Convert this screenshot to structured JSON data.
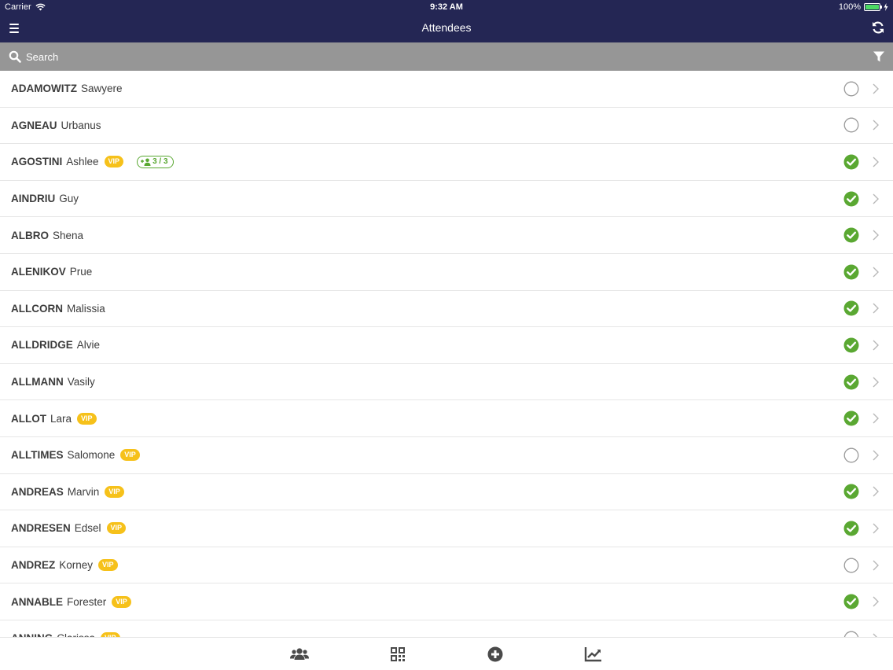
{
  "status_bar": {
    "carrier": "Carrier",
    "time": "9:32 AM",
    "battery": "100%"
  },
  "nav": {
    "title": "Attendees"
  },
  "search": {
    "placeholder": "Search"
  },
  "vip_label": "VIP",
  "attendees": [
    {
      "last": "ADAMOWITZ",
      "first": "Sawyere",
      "vip": false,
      "group": null,
      "checked_in": false
    },
    {
      "last": "AGNEAU",
      "first": "Urbanus",
      "vip": false,
      "group": null,
      "checked_in": false
    },
    {
      "last": "AGOSTINI",
      "first": "Ashlee",
      "vip": true,
      "group": "3 / 3",
      "checked_in": true
    },
    {
      "last": "AINDRIU",
      "first": "Guy",
      "vip": false,
      "group": null,
      "checked_in": true
    },
    {
      "last": "ALBRO",
      "first": "Shena",
      "vip": false,
      "group": null,
      "checked_in": true
    },
    {
      "last": "ALENIKOV",
      "first": "Prue",
      "vip": false,
      "group": null,
      "checked_in": true
    },
    {
      "last": "ALLCORN",
      "first": "Malissia",
      "vip": false,
      "group": null,
      "checked_in": true
    },
    {
      "last": "ALLDRIDGE",
      "first": "Alvie",
      "vip": false,
      "group": null,
      "checked_in": true
    },
    {
      "last": "ALLMANN",
      "first": "Vasily",
      "vip": false,
      "group": null,
      "checked_in": true
    },
    {
      "last": "ALLOT",
      "first": "Lara",
      "vip": true,
      "group": null,
      "checked_in": true
    },
    {
      "last": "ALLTIMES",
      "first": "Salomone",
      "vip": true,
      "group": null,
      "checked_in": false
    },
    {
      "last": "ANDREAS",
      "first": "Marvin",
      "vip": true,
      "group": null,
      "checked_in": true
    },
    {
      "last": "ANDRESEN",
      "first": "Edsel",
      "vip": true,
      "group": null,
      "checked_in": true
    },
    {
      "last": "ANDREZ",
      "first": "Korney",
      "vip": true,
      "group": null,
      "checked_in": false
    },
    {
      "last": "ANNABLE",
      "first": "Forester",
      "vip": true,
      "group": null,
      "checked_in": true
    },
    {
      "last": "ANNING",
      "first": "Clarissa",
      "vip": true,
      "group": null,
      "checked_in": false
    }
  ],
  "tabs": [
    {
      "icon": "attendees-icon"
    },
    {
      "icon": "qr-code-icon"
    },
    {
      "icon": "add-circle-icon"
    },
    {
      "icon": "chart-line-icon"
    }
  ],
  "colors": {
    "nav_bg": "#242654",
    "search_bg": "#969696",
    "check_green": "#5aa832",
    "vip_yellow": "#f6c11a",
    "unchecked_gray": "#9a9a9a",
    "tab_icon": "#4a4a4a"
  }
}
